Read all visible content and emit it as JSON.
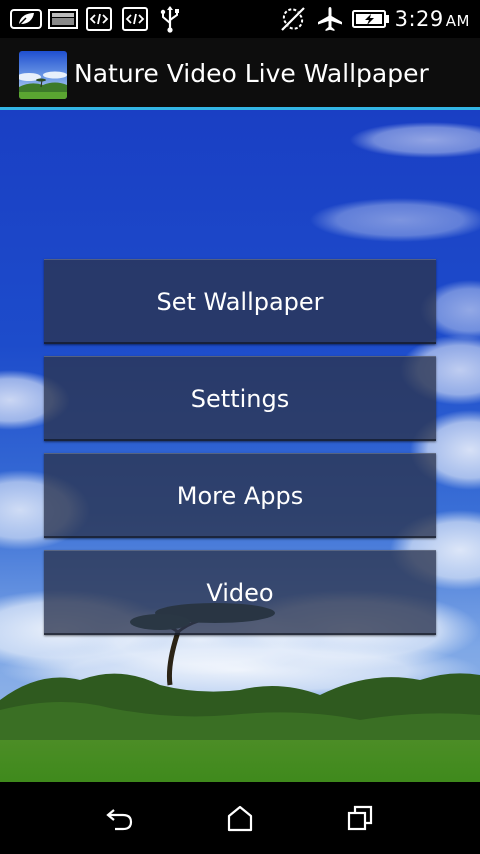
{
  "status_bar": {
    "time": "3:29",
    "ampm": "AM",
    "icons": [
      "leaf-notification-icon",
      "photo-notification-icon",
      "code-notification-icon",
      "code-notification-icon",
      "usb-icon",
      "no-sync-icon",
      "airplane-mode-icon",
      "battery-charging-icon"
    ]
  },
  "action_bar": {
    "title": "Nature Video Live Wallpaper"
  },
  "menu": {
    "buttons": [
      {
        "label": "Set Wallpaper"
      },
      {
        "label": "Settings"
      },
      {
        "label": "More Apps"
      },
      {
        "label": "Video"
      }
    ]
  },
  "nav_bar": {
    "icons": [
      "back-icon",
      "home-icon",
      "recent-apps-icon"
    ]
  },
  "colors": {
    "accent": "#33b5e5",
    "sky": "#1b45c9",
    "button_bg": "#2c3450"
  }
}
